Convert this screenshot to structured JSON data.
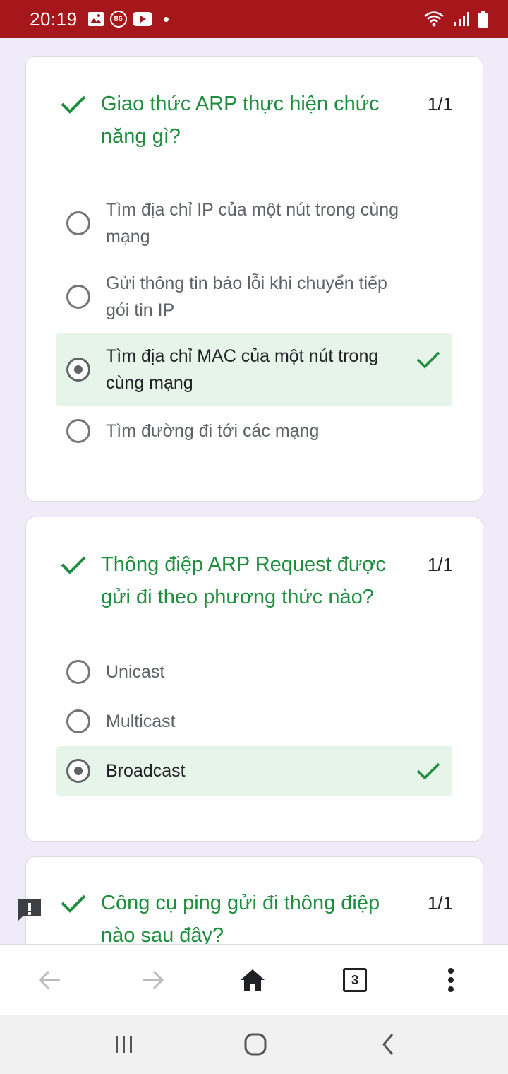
{
  "status_bar": {
    "time": "20:19",
    "badge": "86",
    "icons": [
      "image-icon",
      "youtube-icon",
      "notification-dot",
      "wifi-icon",
      "signal-icon",
      "battery-icon"
    ]
  },
  "colors": {
    "status_bar": "#a5171b",
    "page_bg": "#f0ebf8",
    "correct_green": "#1e8e3e",
    "correct_bg": "#e6f4ea"
  },
  "questions": [
    {
      "title": "Giao thức ARP thực hiện chức năng gì?",
      "score": "1/1",
      "options": [
        {
          "label": "Tìm địa chỉ IP của một nút trong cùng mạng",
          "selected": false,
          "correct": false
        },
        {
          "label": "Gửi thông tin báo lỗi khi chuyển tiếp gói tin IP",
          "selected": false,
          "correct": false
        },
        {
          "label": "Tìm địa chỉ MAC của một nút trong cùng mạng",
          "selected": true,
          "correct": true
        },
        {
          "label": "Tìm đường đi tới các mạng",
          "selected": false,
          "correct": false
        }
      ]
    },
    {
      "title": "Thông điệp ARP Request được gửi đi theo phương thức nào?",
      "score": "1/1",
      "options": [
        {
          "label": "Unicast",
          "selected": false,
          "correct": false
        },
        {
          "label": "Multicast",
          "selected": false,
          "correct": false
        },
        {
          "label": "Broadcast",
          "selected": true,
          "correct": true
        }
      ]
    },
    {
      "title": "Công cụ ping gửi đi thông điệp nào sau đây?",
      "score": "1/1",
      "options": []
    }
  ],
  "browser_toolbar": {
    "tab_count": "3",
    "icons": [
      "back-arrow-icon",
      "forward-arrow-icon",
      "home-icon",
      "tab-switcher",
      "more-vert-icon"
    ]
  },
  "system_nav": {
    "icons": [
      "recents-icon",
      "home-circle-icon",
      "back-icon"
    ]
  }
}
